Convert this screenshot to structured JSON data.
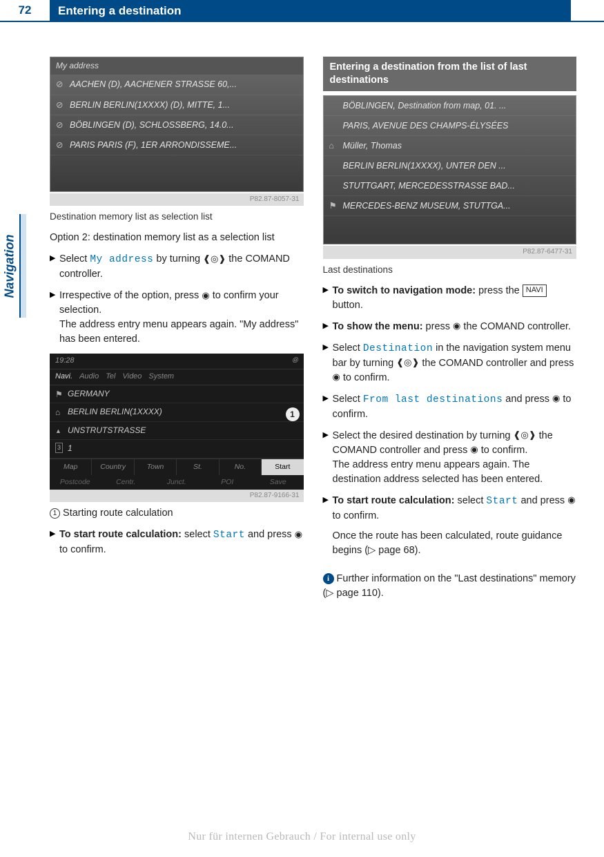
{
  "header": {
    "page_num": "72",
    "title": "Entering a destination"
  },
  "side_tab": "Navigation",
  "left": {
    "shot1": {
      "hdr": "My address",
      "rows": [
        "AACHEN (D), AACHENER STRASSE 60,...",
        "BERLIN BERLIN(1XXXX) (D), MITTE, 1...",
        "BÖBLINGEN (D), SCHLOSSBERG, 14.0...",
        "PARIS PARIS (F), 1ER ARRONDISSEME..."
      ],
      "imgid": "P82.87-8057-31"
    },
    "caption1": "Destination memory list as selection list",
    "option2": "Option 2: destination memory list as a selection list",
    "step1_a": "Select ",
    "step1_cmd": "My address",
    "step1_b": " by turning ",
    "step1_c": " the COMAND controller.",
    "step2_a": "Irrespective of the option, press ",
    "step2_b": " to confirm your selection.",
    "step2_c": "The address entry menu appears again. \"My address\" has been entered.",
    "shot2": {
      "time": "19:28",
      "tabs": [
        "Navi.",
        "Audio",
        "Tel",
        "Video",
        "System"
      ],
      "rows": [
        {
          "cls": "flag",
          "t": "GERMANY"
        },
        {
          "cls": "home",
          "t": "BERLIN BERLIN(1XXXX)"
        },
        {
          "cls": "road",
          "t": "UNSTRUTSTRASSE"
        },
        {
          "cls": "num",
          "t": "1"
        }
      ],
      "bubble": "1",
      "bottom1": [
        "Map",
        "Country",
        "Town",
        "St.",
        "No.",
        "Start"
      ],
      "bottom2": [
        "Postcode",
        "Centr.",
        "Junct.",
        "POI",
        "Save"
      ],
      "imgid": "P82.87-9166-31"
    },
    "legend": "Starting route calculation",
    "step3_a": "To start route calculation:",
    "step3_b": " select ",
    "step3_cmd": "Start",
    "step3_c": " and press ",
    "step3_d": " to confirm."
  },
  "right": {
    "section": "Entering a destination from the list of last destinations",
    "shot1": {
      "rows": [
        {
          "cls": "none",
          "t": "BÖBLINGEN, Destination from map, 01. ..."
        },
        {
          "cls": "none",
          "t": "PARIS, AVENUE DES CHAMPS-ÉLYSÉES"
        },
        {
          "cls": "home",
          "t": "Müller, Thomas"
        },
        {
          "cls": "none",
          "t": "BERLIN BERLIN(1XXXX), UNTER DEN ..."
        },
        {
          "cls": "none",
          "t": "STUTTGART, MERCEDESSTRASSE BAD..."
        },
        {
          "cls": "flag",
          "t": "MERCEDES-BENZ MUSEUM, STUTTGA..."
        }
      ],
      "imgid": "P82.87-6477-31"
    },
    "caption1": "Last destinations",
    "s1_a": "To switch to navigation mode:",
    "s1_b": " press the ",
    "s1_c": " button.",
    "navi": "NAVI",
    "s2_a": "To show the menu:",
    "s2_b": " press ",
    "s2_c": " the COMAND controller.",
    "s3_a": "Select ",
    "s3_cmd": "Destination",
    "s3_b": " in the navigation system menu bar by turning ",
    "s3_c": " the COMAND controller and press ",
    "s3_d": " to confirm.",
    "s4_a": "Select ",
    "s4_cmd": "From last destinations",
    "s4_b": " and press ",
    "s4_c": " to confirm.",
    "s5_a": "Select the desired destination by turning ",
    "s5_b": " the COMAND controller and press ",
    "s5_c": " to confirm.",
    "s5_d": "The address entry menu appears again. The destination address selected has been entered.",
    "s6_a": "To start route calculation:",
    "s6_b": " select ",
    "s6_cmd": "Start",
    "s6_c": " and press ",
    "s6_d": " to confirm.",
    "s6_e": "Once the route has been calculated, route guidance begins (▷ page 68).",
    "info": "Further information on the \"Last destinations\" memory (▷ page 110)."
  },
  "watermark": "Nur für internen Gebrauch / For internal use only",
  "glyph": {
    "rotate": "❰◎❱",
    "press": "◉",
    "tri": "▶",
    "circ1": "1"
  }
}
